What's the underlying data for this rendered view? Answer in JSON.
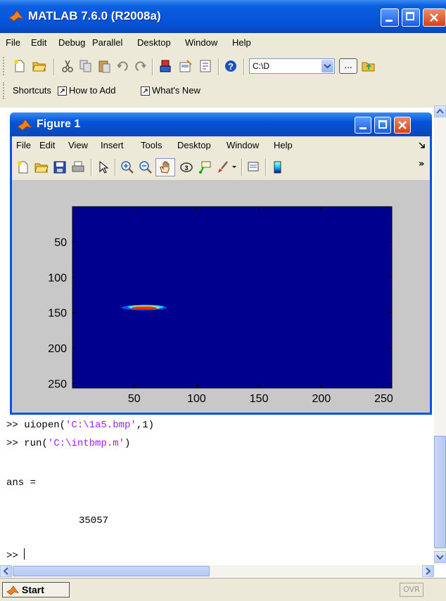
{
  "main_window": {
    "title": "MATLAB  7.6.0 (R2008a)"
  },
  "main_menu": [
    "File",
    "Edit",
    "Debug",
    "Parallel",
    "Desktop",
    "Window",
    "Help"
  ],
  "current_dir": {
    "value": "C:\\D",
    "browse_label": "..."
  },
  "shortcuts": {
    "label": "Shortcuts",
    "how_to_add": "How to Add",
    "whats_new": "What's New"
  },
  "figure": {
    "title": "Figure 1",
    "menu": [
      "File",
      "Edit",
      "View",
      "Insert",
      "Tools",
      "Desktop",
      "Window",
      "Help"
    ],
    "overflow_chevron": "»"
  },
  "chart_data": {
    "type": "heatmap",
    "title": "",
    "xlabel": "",
    "ylabel": "",
    "x_ticks": [
      50,
      100,
      150,
      200,
      250
    ],
    "y_ticks": [
      50,
      100,
      150,
      200,
      250
    ],
    "xlim": [
      0.5,
      256.5
    ],
    "ylim": [
      0.5,
      256.5
    ],
    "y_reversed": true,
    "background_color": "#00008f",
    "blob": {
      "x_range": [
        38,
        72
      ],
      "y_range": [
        136,
        150
      ],
      "center": [
        58,
        143
      ],
      "colors": [
        "#ff2000",
        "#ffe000",
        "#20d0ff",
        "#0050ff"
      ]
    }
  },
  "console": {
    "lines": [
      {
        "prompt": ">> ",
        "cmd": "uiopen(",
        "str": "'C:\\1a5.bmp'",
        "rest": ",1)"
      },
      {
        "prompt": ">> ",
        "cmd": "run(",
        "str": "'C:\\intbmp.m'",
        "rest": ")"
      }
    ],
    "ans_label": "ans =",
    "ans_value": "35057",
    "prompt": ">> "
  },
  "statusbar": {
    "start_label": "Start",
    "ovr_label": "OVR"
  },
  "colors": {
    "title_blue": "#0553d8",
    "string_purple": "#a020f0",
    "panel": "#ece9d8",
    "axes_bg": "#00008f"
  }
}
